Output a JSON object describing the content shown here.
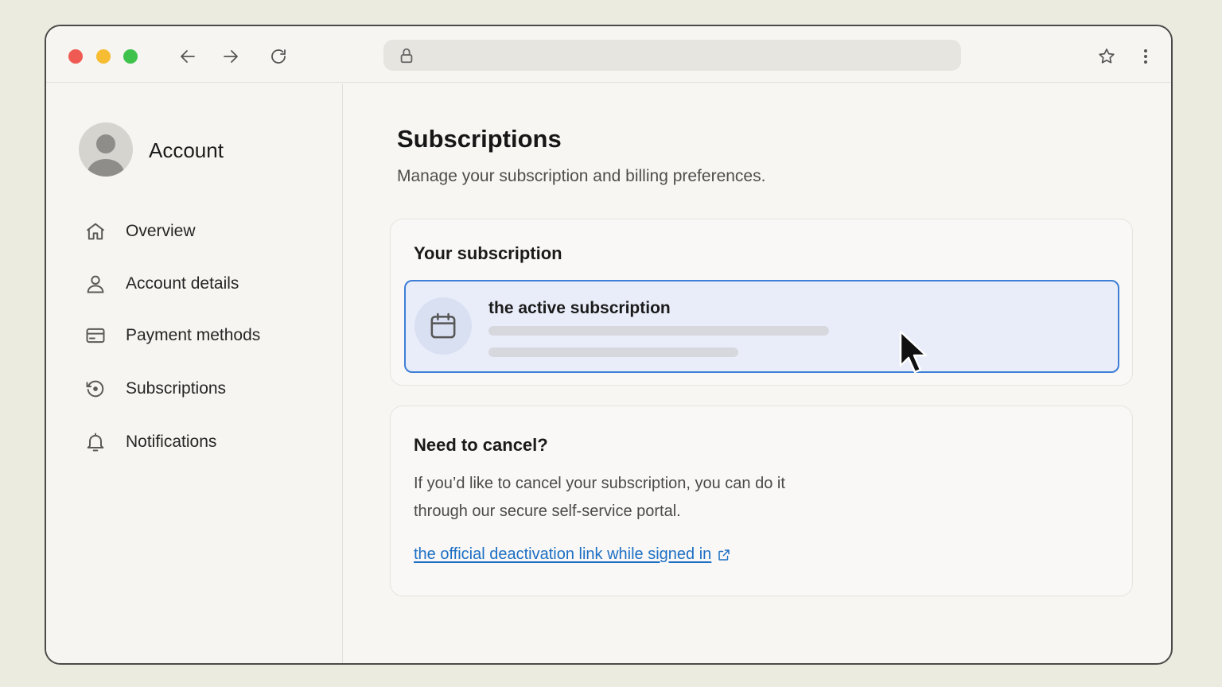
{
  "browser": {
    "url": "",
    "icons": [
      "arrow-left-icon",
      "arrow-right-icon",
      "reload-icon",
      "lock-icon",
      "star-icon",
      "more-vertical-icon"
    ]
  },
  "sidebar": {
    "title": "Account",
    "items": [
      {
        "label": "Overview",
        "icon": "home-icon"
      },
      {
        "label": "Account details",
        "icon": "user-icon"
      },
      {
        "label": "Payment methods",
        "icon": "credit-card-icon"
      },
      {
        "label": "Subscriptions",
        "icon": "subscription-cycle-icon"
      },
      {
        "label": "Notifications",
        "icon": "bell-icon"
      }
    ]
  },
  "main": {
    "title": "Subscriptions",
    "subtitle": "Manage your subscription and billing preferences.",
    "subscription_card": {
      "title": "Your subscription",
      "item_name": "the active subscription",
      "item_icon": "calendar-icon"
    },
    "cancel_card": {
      "title": "Need to cancel?",
      "body_line1": "If you’d like to cancel your subscription, you can do it",
      "body_line2": "through our secure self-service portal.",
      "link_label": "the official deactivation link while signed in",
      "link_icon": "external-link-icon"
    }
  },
  "colors": {
    "accent": "#3d7fd6",
    "link": "#1d6fc4",
    "selected_bg": "#e9edf9"
  }
}
